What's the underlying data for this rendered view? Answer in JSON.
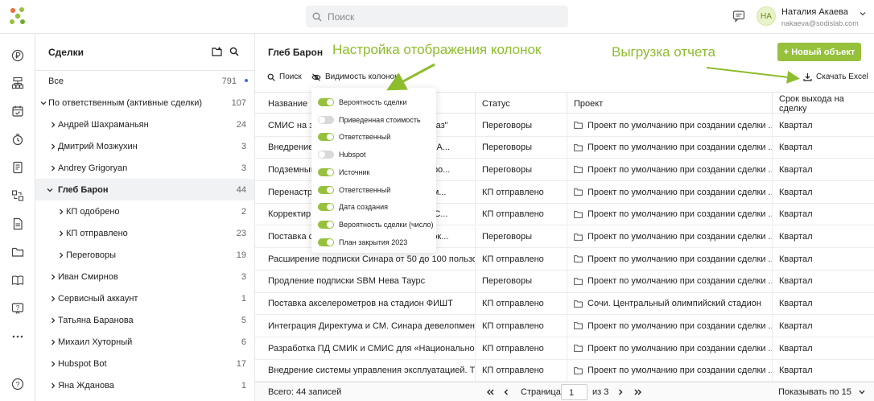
{
  "search": {
    "placeholder": "Поиск"
  },
  "user": {
    "initials": "НА",
    "name": "Наталия Акаева",
    "email": "nakaeva@sodislab.com"
  },
  "sidebar_icons": [
    "ruble-icon",
    "hierarchy-icon",
    "calendar-icon",
    "timer-icon",
    "document-icon",
    "tasks-icon",
    "file-icon",
    "folder-icon",
    "book-icon",
    "help-chat-icon",
    "more-icon",
    "question-icon"
  ],
  "tree": {
    "title": "Сделки",
    "all": {
      "label": "Все",
      "count": "791"
    },
    "by_owner": {
      "label": "По ответственным (активные сделки)",
      "count": "107"
    },
    "owners": [
      {
        "label": "Андрей Шахраманьян",
        "count": "24"
      },
      {
        "label": "Дмитрий Мозжухин",
        "count": "3"
      },
      {
        "label": "Andrey Grigoryan",
        "count": "3"
      },
      {
        "label": "Глеб Барон",
        "count": "44"
      }
    ],
    "substatuses": [
      {
        "label": "КП одобрено",
        "count": "2"
      },
      {
        "label": "КП отправлено",
        "count": "23"
      },
      {
        "label": "Переговоры",
        "count": "19"
      }
    ],
    "owners_rest": [
      {
        "label": "Иван Смирнов",
        "count": "3"
      },
      {
        "label": "Сервисный аккаунт",
        "count": "1"
      },
      {
        "label": "Татьяна Баранова",
        "count": "5"
      },
      {
        "label": "Михаил Хуторный",
        "count": "6"
      },
      {
        "label": "Hubspot Bot",
        "count": "17"
      },
      {
        "label": "Яна Жданова",
        "count": "1"
      }
    ]
  },
  "main": {
    "title": "Глеб Барон",
    "new_button": "+ Новый объект",
    "toolbar": {
      "search": "Поиск",
      "columns": "Видимость колонок",
      "export": "Скачать Excel"
    },
    "columns": [
      "Название",
      "Статус",
      "Проект",
      "Срок выхода на сделку"
    ],
    "rows": [
      {
        "name_a": "СМИС на за",
        "name_b": "фтегаз\"",
        "status": "Переговоры",
        "project": "Проект по умолчанию при создании сделки ...",
        "term": "Квартал"
      },
      {
        "name_a": "Внедрение",
        "name_b": "ией. А...",
        "status": "Переговоры",
        "project": "Проект по умолчанию при создании сделки ...",
        "term": "Квартал"
      },
      {
        "name_a": "Подземный",
        "name_b": "к поро...",
        "status": "Переговоры",
        "project": "Проект по умолчанию при создании сделки ...",
        "term": "Квартал"
      },
      {
        "name_a": "Перенастро",
        "name_b": "с изм...",
        "status": "КП отправлено",
        "project": "Проект по умолчанию при создании сделки ...",
        "term": "Квартал"
      },
      {
        "name_a": "Корректир",
        "name_b": "ела С...",
        "status": "КП отправлено",
        "project": "Проект по умолчанию при создании сделки ...",
        "term": "Квартал"
      },
      {
        "name_a": "Поставка с",
        "name_b": "м и эк...",
        "status": "Переговоры",
        "project": "Проект по умолчанию при создании сделки ...",
        "term": "Квартал"
      },
      {
        "name_a": "Расширение подписки Синара от 50 до 100 пользо...",
        "name_b": "",
        "status": "КП отправлено",
        "project": "Проект по умолчанию при создании сделки ...",
        "term": "Квартал"
      },
      {
        "name_a": "Продление подписки SBM Нева Таурс",
        "name_b": "",
        "status": "Переговоры",
        "project": "Проект по умолчанию при создании сделки ...",
        "term": "Квартал"
      },
      {
        "name_a": "Поставка акселерометров на стадион ФИШТ",
        "name_b": "",
        "status": "КП отправлено",
        "project": "Сочи. Центральный олимпийский стадион",
        "term": "Квартал"
      },
      {
        "name_a": "Интеграция Директума и СМ. Синара девелопмент",
        "name_b": "",
        "status": "КП отправлено",
        "project": "Проект по умолчанию при создании сделки ...",
        "term": "Квартал"
      },
      {
        "name_a": "Разработка ПД СМИК и СМИС для «Национальног...",
        "name_b": "",
        "status": "КП отправлено",
        "project": "Проект по умолчанию при создании сделки ...",
        "term": "Квартал"
      },
      {
        "name_a": "Внедрение системы управления эксплуатацией. Т...",
        "name_b": "",
        "status": "КП отправлено",
        "project": "Проект по умолчанию при создании сделки ...",
        "term": "Квартал"
      }
    ],
    "footer": {
      "total": "Всего: 44 записей",
      "page_label": "Страница",
      "page": "1",
      "of": "из 3",
      "per_page": "Показывать по 15"
    }
  },
  "column_popup": [
    {
      "label": "Вероятность сделки",
      "on": true
    },
    {
      "label": "Приведенная стоимость",
      "on": false
    },
    {
      "label": "Ответственный",
      "on": true
    },
    {
      "label": "Hubspot",
      "on": false
    },
    {
      "label": "Источник",
      "on": true
    },
    {
      "label": "Ответственный",
      "on": true
    },
    {
      "label": "Дата создания",
      "on": true
    },
    {
      "label": "Вероятность сделки (число)",
      "on": true
    },
    {
      "label": "План закрытия 2023",
      "on": true
    }
  ],
  "annotations": {
    "columns": "Настройка отображения колонок",
    "export": "Выгрузка отчета"
  },
  "colors": {
    "accent": "#95c13d",
    "annotation": "#8dbd2c"
  }
}
